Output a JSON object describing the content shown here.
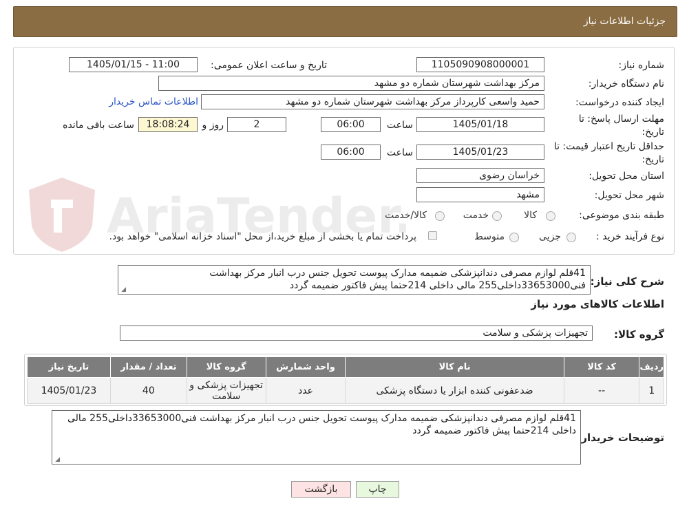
{
  "header": {
    "title": "جزئیات اطلاعات نیاز"
  },
  "fields": {
    "need_number_label": "شماره نیاز:",
    "need_number": "1105090908000001",
    "announce_label": "تاریخ و ساعت اعلان عمومی:",
    "announce_value": "1405/01/15 - 11:00",
    "buyer_org_label": "نام دستگاه خریدار:",
    "buyer_org": "مرکز بهداشت شهرستان شماره دو مشهد",
    "creator_label": "ایجاد کننده درخواست:",
    "creator": "حمید واسعی کارپرداز مرکز بهداشت شهرستان شماره دو مشهد",
    "contact_link": "اطلاعات تماس خریدار",
    "deadline_label_1": "مهلت ارسال پاسخ: تا",
    "deadline_label_2": "تاریخ:",
    "deadline_date": "1405/01/18",
    "time_label": "ساعت",
    "deadline_time": "06:00",
    "days_value": "2",
    "days_label": "روز و",
    "remaining_time": "18:08:24",
    "remaining_label": "ساعت باقی مانده",
    "validity_label_1": "حداقل تاریخ اعتبار قیمت: تا",
    "validity_label_2": "تاریخ:",
    "validity_date": "1405/01/23",
    "validity_time": "06:00",
    "province_label": "استان محل تحویل:",
    "province": "خراسان رضوی",
    "city_label": "شهر محل تحویل:",
    "city": "مشهد",
    "category_label": "طبقه بندی موضوعی:",
    "category_options": [
      "کالا",
      "خدمت",
      "کالا/خدمت"
    ],
    "process_label": "نوع فرآیند خرید :",
    "process_options": [
      "جزیی",
      "متوسط"
    ],
    "payment_note": "پرداخت تمام یا بخشی از مبلغ خرید،از محل \"اسناد خزانه اسلامی\" خواهد بود."
  },
  "description": {
    "label": "شرح کلی نیاز:",
    "text": "41قلم لوازم مصرفی دندانپزشکی ضمیمه مدارک پیوست تحویل جنس درب انبار مرکز بهداشت فنی33653000داخلی255 مالی داخلی 214حتما پیش فاکتور ضمیمه گردد"
  },
  "goods_section_title": "اطلاعات کالاهای مورد نیاز",
  "goods_group": {
    "label": "گروه کالا:",
    "value": "تجهیزات پزشکی و سلامت"
  },
  "table": {
    "headers": [
      "ردیف",
      "کد کالا",
      "نام کالا",
      "واحد شمارش",
      "گروه کالا",
      "تعداد / مقدار",
      "تاریخ نیاز"
    ],
    "rows": [
      [
        "1",
        "--",
        "ضدعفونی کننده ابزار یا دستگاه پزشکی",
        "عدد",
        "تجهیزات پزشکی و سلامت",
        "40",
        "1405/01/23"
      ]
    ]
  },
  "buyer_notes": {
    "label": "توضیحات خریدار:",
    "text": "41قلم لوازم مصرفی دندانپزشکی ضمیمه مدارک پیوست تحویل جنس درب انبار مرکز بهداشت فنی33653000داخلی255 مالی داخلی 214حتما پیش فاکتور ضمیمه گردد"
  },
  "buttons": {
    "print": "چاپ",
    "back": "بازگشت"
  },
  "watermark": {
    "text": "AriaTender.neT"
  },
  "colors": {
    "header_bg": "#8b6d43",
    "table_header_bg": "#7d7d7d",
    "link": "#2a56c6",
    "back_btn_bg": "#fde3e3",
    "print_btn_bg": "#e8f8de"
  }
}
